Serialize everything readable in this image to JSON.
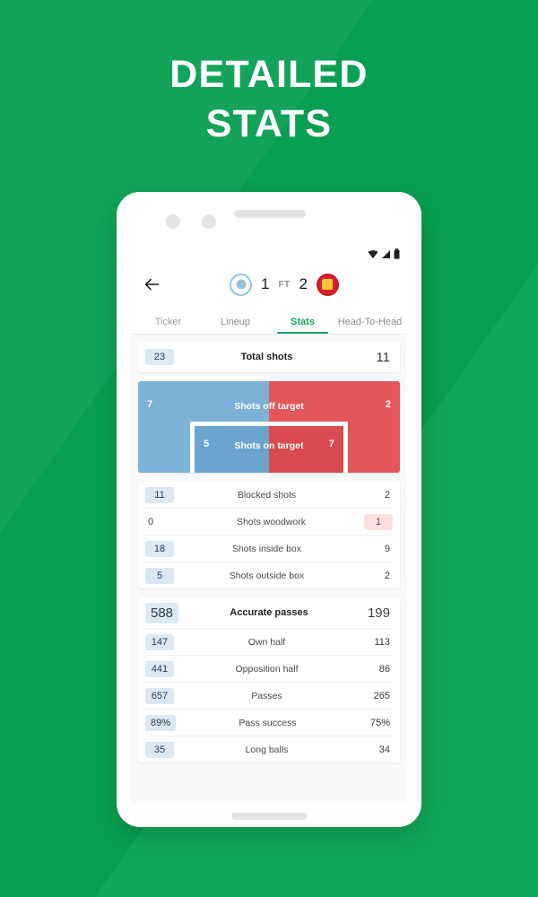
{
  "promo": {
    "line1": "DETAILED",
    "line2": "STATS"
  },
  "statusbar": {
    "wifi_icon": "wifi-icon",
    "signal_icon": "signal-icon",
    "battery_icon": "battery-icon"
  },
  "match_header": {
    "back_icon": "back-arrow-icon",
    "home_team_crest": "man-city-crest",
    "home_score": "1",
    "status": "FT",
    "away_score": "2",
    "away_team_crest": "man-united-crest"
  },
  "tabs": [
    {
      "label": "Ticker",
      "active": false
    },
    {
      "label": "Lineup",
      "active": false
    },
    {
      "label": "Stats",
      "active": true
    },
    {
      "label": "Head-To-Head",
      "active": false
    }
  ],
  "stats": {
    "shots_card": {
      "total": {
        "label": "Total shots",
        "home": "23",
        "away": "11"
      },
      "goal_graphic": {
        "off_target": {
          "label": "Shots off target",
          "home": "7",
          "away": "2"
        },
        "on_target": {
          "label": "Shots on target",
          "home": "5",
          "away": "7"
        }
      },
      "rows": [
        {
          "label": "Blocked shots",
          "home": "11",
          "away": "2",
          "home_highlight": "blue",
          "away_highlight": "none"
        },
        {
          "label": "Shots woodwork",
          "home": "0",
          "away": "1",
          "home_highlight": "none",
          "away_highlight": "red"
        },
        {
          "label": "Shots inside box",
          "home": "18",
          "away": "9",
          "home_highlight": "blue",
          "away_highlight": "none"
        },
        {
          "label": "Shots outside box",
          "home": "5",
          "away": "2",
          "home_highlight": "blue",
          "away_highlight": "none"
        }
      ]
    },
    "passes_card": {
      "total": {
        "label": "Accurate passes",
        "home": "588",
        "away": "199"
      },
      "rows": [
        {
          "label": "Own half",
          "home": "147",
          "away": "113",
          "home_highlight": "blue",
          "away_highlight": "none"
        },
        {
          "label": "Opposition half",
          "home": "441",
          "away": "86",
          "home_highlight": "blue",
          "away_highlight": "none"
        },
        {
          "label": "Passes",
          "home": "657",
          "away": "265",
          "home_highlight": "blue",
          "away_highlight": "none"
        },
        {
          "label": "Pass success",
          "home": "89%",
          "away": "75%",
          "home_highlight": "blue",
          "away_highlight": "none"
        },
        {
          "label": "Long balls",
          "home": "35",
          "away": "34",
          "home_highlight": "blue",
          "away_highlight": "none"
        }
      ]
    }
  },
  "navbar": {
    "back_label": "‹",
    "home_pill": "home-indicator"
  },
  "colors": {
    "background_green": "#08a455",
    "accent_green": "#1aa463",
    "home_blue": "#7cb2d8",
    "away_red": "#e2565c"
  }
}
